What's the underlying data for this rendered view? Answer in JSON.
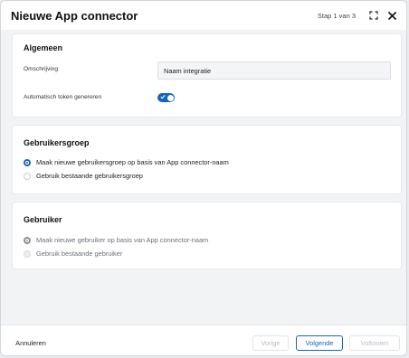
{
  "dialog": {
    "title": "Nieuwe App connector",
    "step": "Stap 1 van 3",
    "icons": {
      "expand": "expand-icon",
      "close": "close-icon"
    }
  },
  "general": {
    "heading": "Algemeen",
    "description_label": "Omschrijving",
    "description_value": "Naam integratie",
    "auto_token_label": "Automatisch token genereren",
    "auto_token_on": true
  },
  "usergroup": {
    "heading": "Gebruikersgroep",
    "options": [
      {
        "label": "Maak nieuwe gebruikersgroep op basis van App connector-naam",
        "selected": true
      },
      {
        "label": "Gebruik bestaande gebruikersgroep",
        "selected": false
      }
    ]
  },
  "user": {
    "heading": "Gebruiker",
    "options": [
      {
        "label": "Maak nieuwe gebruiker op basis van App connector-naam",
        "selected": true
      },
      {
        "label": "Gebruik bestaande gebruiker",
        "selected": false
      }
    ]
  },
  "footer": {
    "cancel": "Annuleren",
    "previous": "Vorige",
    "next": "Volgende",
    "finish": "Voltooien"
  },
  "colors": {
    "accent": "#1565c0",
    "background": "#f2f3f5"
  }
}
